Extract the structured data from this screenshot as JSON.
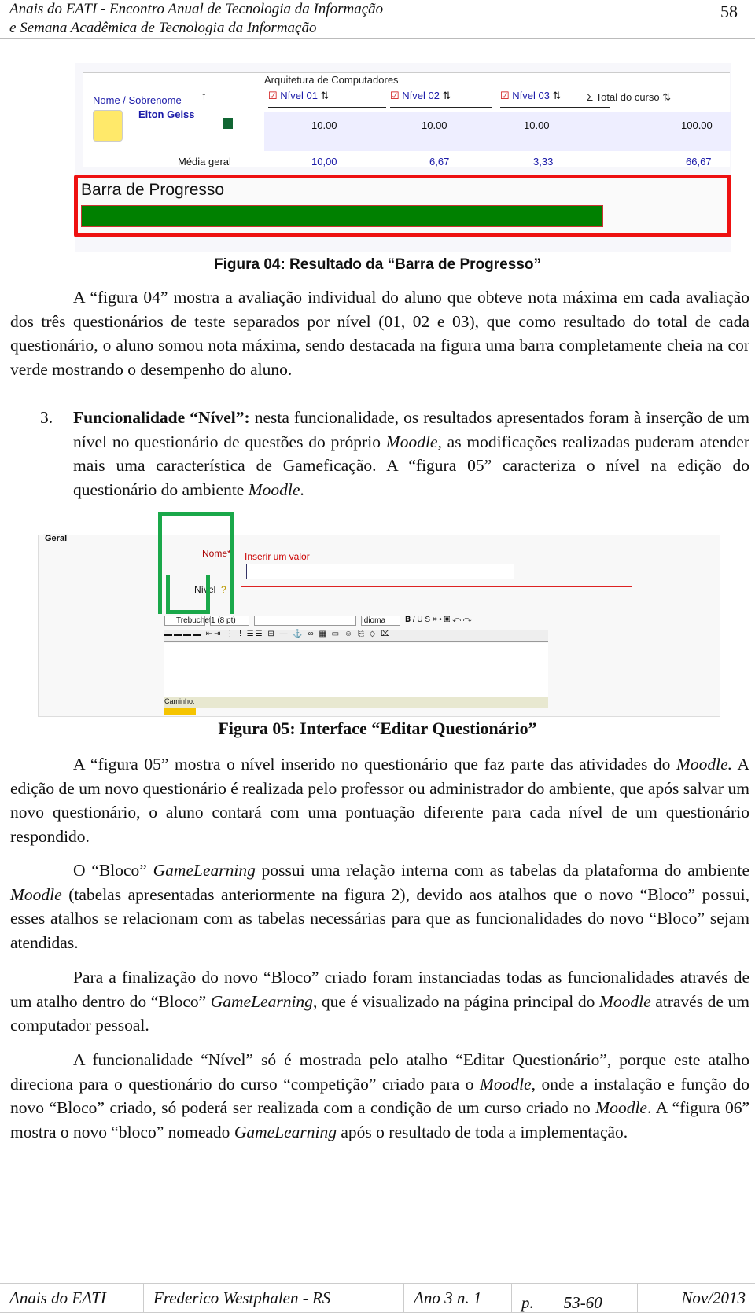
{
  "header": {
    "line1": "Anais do EATI - Encontro Anual de Tecnologia da Informação",
    "line2": "e Semana Acadêmica de Tecnologia da Informação",
    "page_number": "58"
  },
  "figure4": {
    "course": "Arquitetura de Computadores",
    "columns": [
      "Nome / Sobrenome",
      "Nível 01",
      "Nível 02",
      "Nível 03",
      "Total do curso"
    ],
    "student": {
      "name": "Elton Geiss",
      "values": [
        "10.00",
        "10.00",
        "10.00",
        "100.00"
      ]
    },
    "average": {
      "label": "Média geral",
      "values": [
        "10,00",
        "6,67",
        "3,33",
        "66,67"
      ]
    },
    "progress_label": "Barra de Progresso",
    "progress_percent": 100,
    "progress_color": "#008000",
    "highlight_color": "#ee1111",
    "caption": "Figura 04: Resultado da “Barra de Progresso”"
  },
  "paragraphs": [
    {
      "segments": [
        {
          "t": "A “figura 04” mostra a avaliação individual do aluno que obteve nota máxima em cada avaliação dos três questionários de teste separados por nível (01, 02 e 03), que como resultado do total de cada questionário, o aluno somou nota máxima, sendo destacada na figura uma barra completamente cheia na cor verde mostrando o desempenho do aluno."
        }
      ]
    },
    {
      "number": "3.",
      "segments": [
        {
          "t": "Funcionalidade “Nível”:",
          "b": true
        },
        {
          "t": " nesta funcionalidade, os resultados apresentados foram à inserção de um nível no questionário de questões do próprio "
        },
        {
          "t": "Moodle,",
          "i": true
        },
        {
          "t": " as modificações realizadas puderam atender mais uma característica de Gameficação. A “figura 05” caracteriza o nível na edição do questionário do ambiente "
        },
        {
          "t": "Moodle",
          "i": true
        },
        {
          "t": "."
        }
      ]
    },
    {
      "segments": [
        {
          "t": "A “figura 05” mostra o nível inserido no questionário que faz parte das atividades do "
        },
        {
          "t": "Moodle.",
          "i": true
        },
        {
          "t": " A edição de um novo questionário é realizada pelo professor ou administrador do ambiente, que após salvar um novo questionário, o aluno contará com uma pontuação diferente para cada nível de um questionário respondido."
        }
      ]
    },
    {
      "segments": [
        {
          "t": "O “Bloco” "
        },
        {
          "t": "GameLearning",
          "i": true
        },
        {
          "t": " possui uma relação interna com as tabelas da plataforma do ambiente "
        },
        {
          "t": "Moodle",
          "i": true
        },
        {
          "t": " (tabelas apresentadas anteriormente na figura 2), devido aos atalhos que o novo “Bloco” possui, esses atalhos se relacionam com as tabelas necessárias para que as funcionalidades do novo “Bloco” sejam atendidas."
        }
      ]
    },
    {
      "segments": [
        {
          "t": "Para a finalização do novo “Bloco” criado foram instanciadas todas as funcionalidades através de um atalho dentro do “Bloco” "
        },
        {
          "t": "GameLearning",
          "i": true
        },
        {
          "t": ", que é visualizado na página principal do "
        },
        {
          "t": "Moodle",
          "i": true
        },
        {
          "t": " através de um computador pessoal."
        }
      ]
    },
    {
      "segments": [
        {
          "t": "A funcionalidade “Nível” só é mostrada pelo atalho “Editar Questionário”, porque este atalho direciona para o questionário do curso “competição” criado para o "
        },
        {
          "t": "Moodle",
          "i": true
        },
        {
          "t": ", onde a instalação e função do novo “Bloco” criado, só poderá ser realizada com a condição de um curso criado no "
        },
        {
          "t": "Moodle",
          "i": true
        },
        {
          "t": ". A “figura 06” mostra o novo “bloco” nomeado "
        },
        {
          "t": "GameLearning",
          "i": true
        },
        {
          "t": " após o resultado de toda a implementação."
        }
      ]
    }
  ],
  "figure5": {
    "section": "Geral",
    "name_label": "Nome*",
    "error": "Inserir um valor",
    "level_label": "Nível",
    "font_select": "Trebuchet",
    "size_select": "1 (8 pt)",
    "lang_select": "Idioma",
    "path_label": "Caminho:",
    "highlight_color": "#1aa84a",
    "caption": "Figura 05: Interface “Editar Questionário”"
  },
  "footer": {
    "journal": "Anais do EATI",
    "city": "Frederico Westphalen - RS",
    "issue": "Ano 3 n. 1",
    "pages_prefix": "p.",
    "pages": "53-60",
    "date": "Nov/2013"
  }
}
